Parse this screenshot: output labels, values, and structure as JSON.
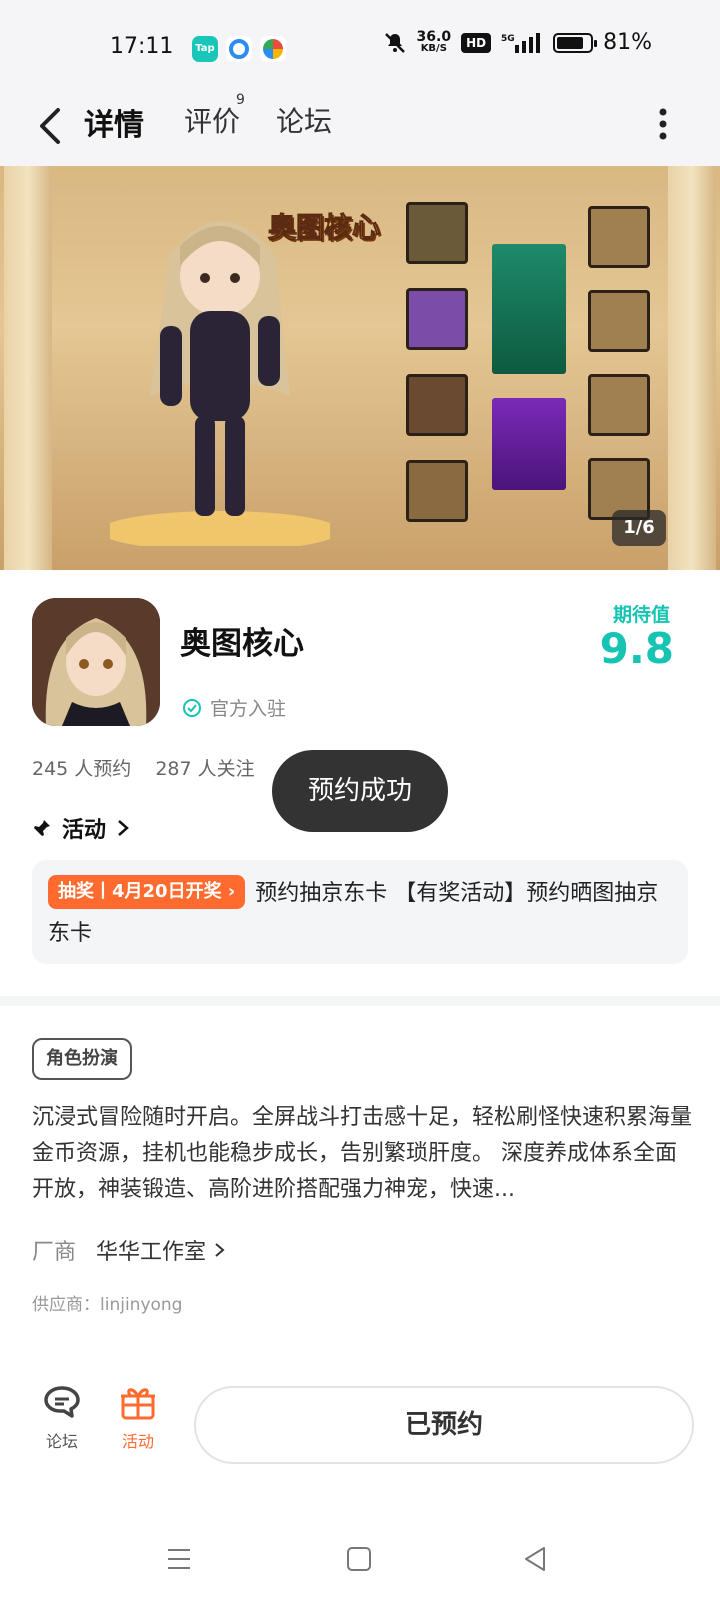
{
  "status_bar": {
    "time": "17:11",
    "app_icons": [
      {
        "name": "tap-app-icon",
        "label": "Tap",
        "color": "#19c6b8"
      },
      {
        "name": "qq-browser-icon",
        "color": "#2d8cf0"
      },
      {
        "name": "colorful-app-icon",
        "color": "#e94b3c"
      }
    ],
    "net_speed_value": "36.0",
    "net_speed_unit": "KB/S",
    "hd_label": "HD",
    "network": "5G",
    "battery_level": 0.81,
    "battery_text": "81%"
  },
  "nav": {
    "tabs": [
      {
        "label": "详情",
        "active": true
      },
      {
        "label": "评价",
        "badge": "9"
      },
      {
        "label": "论坛"
      }
    ]
  },
  "banner": {
    "logo_text": "奥图核心",
    "pager": "1/6"
  },
  "app": {
    "name": "奥图核心",
    "official_label": "官方入驻",
    "expect_label": "期待值",
    "expect_score": "9.8",
    "reservations": "245 人预约",
    "followers": "287 人关注"
  },
  "toast": "预约成功",
  "activity": {
    "heading": "活动",
    "tag": "抽奖丨4月20日开奖",
    "text": "预约抽京东卡 【有奖活动】预约晒图抽京东卡"
  },
  "details": {
    "genre_tag": "角色扮演",
    "description": "沉浸式冒险随时开启。全屏战斗打击感十足，轻松刷怪快速积累海量金币资源，挂机也能稳步成长，告别繁琐肝度。 深度养成体系全面开放，神装锻造、高阶进阶搭配强力神宠，快速...",
    "vendor_label": "厂商",
    "vendor_name": "华华工作室",
    "supplier": "供应商：linjinyong"
  },
  "bottom_bar": {
    "forum_label": "论坛",
    "activity_label": "活动",
    "reserve_label": "已预约"
  },
  "colors": {
    "accent": "#17c3b2",
    "activity_orange": "#ff6a2f"
  }
}
